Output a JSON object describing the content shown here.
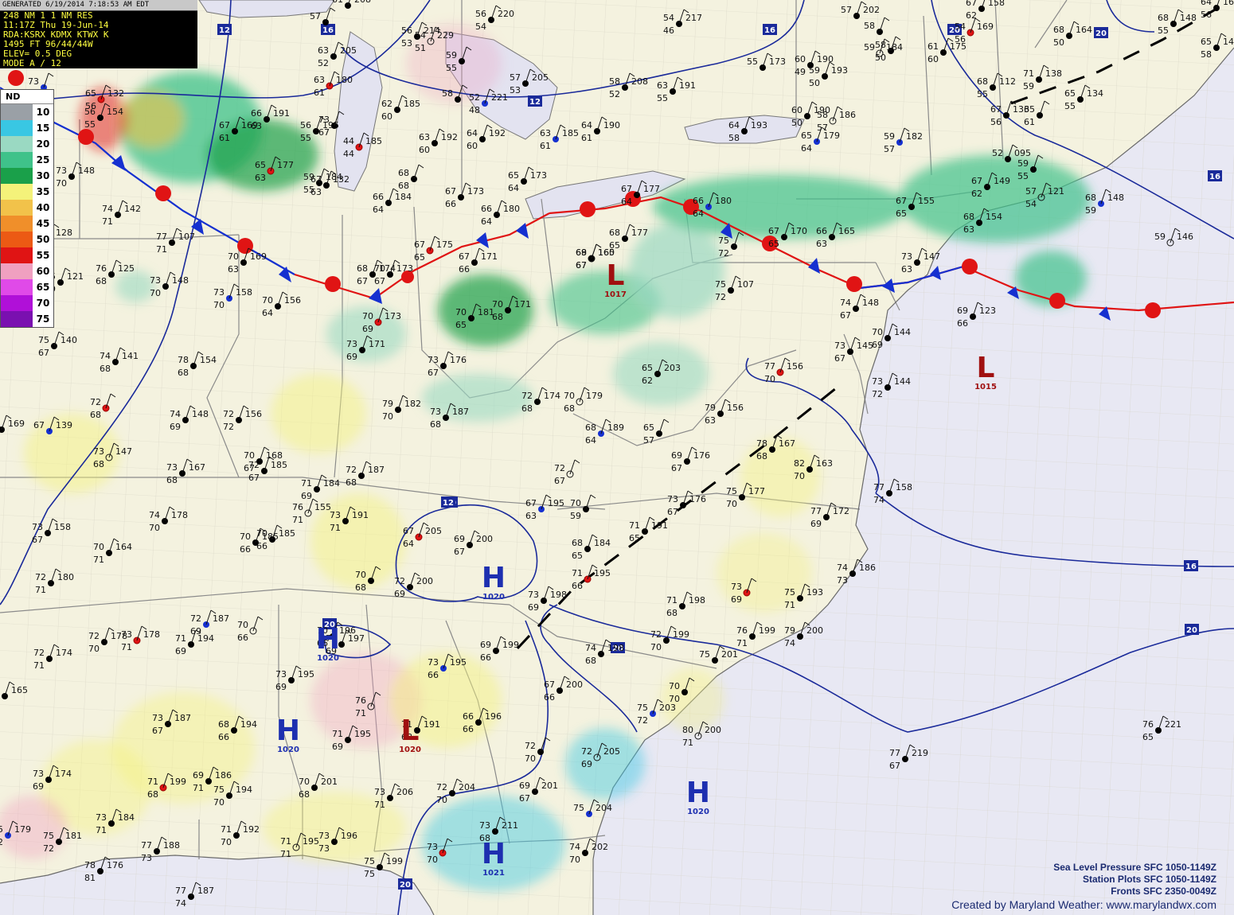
{
  "header": {
    "generated": "GENERATED 6/19/2014 7:18:53 AM EDT",
    "lines": [
      "248 NM 1 1 NM RES",
      "11:17Z Thu 19-Jun-14",
      "RDA:KSRX KDMX KTWX K",
      "1495 FT   96/44/44W",
      "ELEV= 0.5 DEG",
      "MODE A / 12"
    ]
  },
  "legend": {
    "nd_label": "ND",
    "bins": [
      {
        "label": "10",
        "color": "#9aa0a6"
      },
      {
        "label": "15",
        "color": "#39c7e3"
      },
      {
        "label": "20",
        "color": "#9ad9c2"
      },
      {
        "label": "25",
        "color": "#3fc28a"
      },
      {
        "label": "30",
        "color": "#1aa04a"
      },
      {
        "label": "35",
        "color": "#f4f27a"
      },
      {
        "label": "40",
        "color": "#f2c24a"
      },
      {
        "label": "45",
        "color": "#f08f2a"
      },
      {
        "label": "50",
        "color": "#ec5a14"
      },
      {
        "label": "55",
        "color": "#e01414"
      },
      {
        "label": "60",
        "color": "#f0a0c0"
      },
      {
        "label": "65",
        "color": "#e04ae8"
      },
      {
        "label": "70",
        "color": "#b010d8"
      },
      {
        "label": "75",
        "color": "#7a10b0"
      }
    ]
  },
  "centers": [
    {
      "type": "L",
      "value": "1017"
    },
    {
      "type": "L",
      "value": "1015"
    },
    {
      "type": "H",
      "value": "1020"
    },
    {
      "type": "H",
      "value": "1020"
    },
    {
      "type": "H",
      "value": "1020"
    },
    {
      "type": "L",
      "value": "1020"
    },
    {
      "type": "H",
      "value": "1020"
    },
    {
      "type": "H",
      "value": "1021"
    }
  ],
  "isobar_labels": [
    "12",
    "16",
    "20",
    "20",
    "20",
    "16",
    "12",
    "16",
    "20",
    "20",
    "20",
    "20",
    "12",
    "16",
    "20"
  ],
  "stations": [
    {
      "t": "73",
      "d": "70",
      "p": ""
    },
    {
      "t": "70",
      "d": "67",
      "p": "173"
    },
    {
      "t": "67",
      "d": "61",
      "p": "169"
    },
    {
      "t": "66",
      "d": "63",
      "p": "191"
    },
    {
      "t": "65",
      "d": "63",
      "p": "177"
    },
    {
      "t": "58",
      "d": "52",
      "p": "208"
    },
    {
      "t": "63",
      "d": "55",
      "p": "191"
    },
    {
      "t": "64",
      "d": "58",
      "p": "193"
    },
    {
      "t": "67",
      "d": "65",
      "p": "170"
    },
    {
      "t": "66",
      "d": "63",
      "p": "165"
    },
    {
      "t": "67",
      "d": "65",
      "p": "155"
    },
    {
      "t": "68",
      "d": "63",
      "p": "154"
    },
    {
      "t": "67",
      "d": "62",
      "p": "149"
    },
    {
      "t": "59",
      "d": "",
      "p": "146"
    },
    {
      "t": "66",
      "d": "64",
      "p": "180"
    },
    {
      "t": "67",
      "d": "64",
      "p": "177"
    },
    {
      "t": "70",
      "d": "65",
      "p": "181"
    },
    {
      "t": "68",
      "d": "65",
      "p": "177"
    },
    {
      "t": "70",
      "d": "69",
      "p": "173"
    },
    {
      "t": "73",
      "d": "69",
      "p": "171"
    },
    {
      "t": "78",
      "d": "68",
      "p": "154"
    },
    {
      "t": "74",
      "d": "68",
      "p": "141"
    },
    {
      "t": "75",
      "d": "67",
      "p": "140"
    },
    {
      "t": "73",
      "d": "67",
      "p": "176"
    },
    {
      "t": "79",
      "d": "70",
      "p": "182"
    },
    {
      "t": "73",
      "d": "68",
      "p": "187"
    },
    {
      "t": "72",
      "d": "68",
      "p": "174"
    },
    {
      "t": "70",
      "d": "68",
      "p": "179"
    },
    {
      "t": "68",
      "d": "64",
      "p": "189"
    },
    {
      "t": "65",
      "d": "57",
      "p": ""
    },
    {
      "t": "65",
      "d": "62",
      "p": "203"
    },
    {
      "t": "79",
      "d": "63",
      "p": "156"
    },
    {
      "t": "77",
      "d": "70",
      "p": "156"
    },
    {
      "t": "73",
      "d": "63",
      "p": "147"
    },
    {
      "t": "73",
      "d": "67",
      "p": "145"
    },
    {
      "t": "74",
      "d": "67",
      "p": "148"
    },
    {
      "t": "70",
      "d": "69",
      "p": "144"
    },
    {
      "t": "73",
      "d": "72",
      "p": "144"
    },
    {
      "t": "69",
      "d": "66",
      "p": "123"
    },
    {
      "t": "76",
      "d": "65",
      "p": "221"
    },
    {
      "t": "77",
      "d": "67",
      "p": "219"
    },
    {
      "t": "80",
      "d": "71",
      "p": "200"
    },
    {
      "t": "75",
      "d": "72",
      "p": "203"
    },
    {
      "t": "76",
      "d": "71",
      "p": "199"
    },
    {
      "t": "79",
      "d": "74",
      "p": "200"
    },
    {
      "t": "75",
      "d": "71",
      "p": "193"
    },
    {
      "t": "73",
      "d": "69",
      "p": ""
    },
    {
      "t": "77",
      "d": "69",
      "p": "172"
    },
    {
      "t": "74",
      "d": "73",
      "p": "186"
    },
    {
      "t": "77",
      "d": "74",
      "p": "158"
    },
    {
      "t": "82",
      "d": "70",
      "p": "163"
    },
    {
      "t": "78",
      "d": "68",
      "p": "167"
    },
    {
      "t": "75",
      "d": "70",
      "p": "177"
    },
    {
      "t": "73",
      "d": "67",
      "p": "176"
    },
    {
      "t": "69",
      "d": "67",
      "p": "176"
    },
    {
      "t": "72",
      "d": "67",
      "p": ""
    },
    {
      "t": "67",
      "d": "63",
      "p": "195"
    },
    {
      "t": "70",
      "d": "59",
      "p": ""
    },
    {
      "t": "68",
      "d": "65",
      "p": "184"
    },
    {
      "t": "71",
      "d": "65",
      "p": "191"
    },
    {
      "t": "71",
      "d": "66",
      "p": "195"
    },
    {
      "t": "73",
      "d": "69",
      "p": "198"
    },
    {
      "t": "71",
      "d": "68",
      "p": "198"
    },
    {
      "t": "72",
      "d": "70",
      "p": "199"
    },
    {
      "t": "74",
      "d": "68",
      "p": "198"
    },
    {
      "t": "75",
      "d": "",
      "p": "201"
    },
    {
      "t": "67",
      "d": "66",
      "p": "200"
    },
    {
      "t": "70",
      "d": "70",
      "p": ""
    },
    {
      "t": "72",
      "d": "70",
      "p": ""
    },
    {
      "t": "72",
      "d": "69",
      "p": "205"
    },
    {
      "t": "75",
      "d": "",
      "p": "204"
    },
    {
      "t": "74",
      "d": "70",
      "p": "202"
    },
    {
      "t": "69",
      "d": "67",
      "p": "201"
    },
    {
      "t": "73",
      "d": "68",
      "p": "211"
    },
    {
      "t": "73",
      "d": "70",
      "p": ""
    },
    {
      "t": "72",
      "d": "70",
      "p": "204"
    },
    {
      "t": "73",
      "d": "71",
      "p": "206"
    },
    {
      "t": "70",
      "d": "68",
      "p": "201"
    },
    {
      "t": "73",
      "d": "73",
      "p": "196"
    },
    {
      "t": "75",
      "d": "75",
      "p": "199"
    },
    {
      "t": "71",
      "d": "69",
      "p": "195"
    },
    {
      "t": "66",
      "d": "66",
      "p": "196"
    },
    {
      "t": "71",
      "d": "68",
      "p": "191"
    },
    {
      "t": "76",
      "d": "71",
      "p": ""
    },
    {
      "t": "73",
      "d": "66",
      "p": "195"
    },
    {
      "t": "69",
      "d": "66",
      "p": "199"
    },
    {
      "t": "72",
      "d": "69",
      "p": "200"
    },
    {
      "t": "70",
      "d": "68",
      "p": ""
    },
    {
      "t": "67",
      "d": "64",
      "p": "205"
    },
    {
      "t": "69",
      "d": "67",
      "p": "200"
    },
    {
      "t": "73",
      "d": "71",
      "p": "191"
    },
    {
      "t": "70",
      "d": "66",
      "p": "185"
    },
    {
      "t": "72",
      "d": "68",
      "p": "187"
    },
    {
      "t": "71",
      "d": "69",
      "p": "184"
    },
    {
      "t": "70",
      "d": "66",
      "p": "196"
    },
    {
      "t": "73",
      "d": "69",
      "p": "195"
    },
    {
      "t": "70",
      "d": "69",
      "p": "197"
    },
    {
      "t": "70",
      "d": "66",
      "p": ""
    },
    {
      "t": "72",
      "d": "69",
      "p": "187"
    },
    {
      "t": "68",
      "d": "66",
      "p": "194"
    },
    {
      "t": "73",
      "d": "67",
      "p": "187"
    },
    {
      "t": "72",
      "d": "70",
      "p": "178"
    },
    {
      "t": "73",
      "d": "71",
      "p": "178"
    },
    {
      "t": "72",
      "d": "71",
      "p": "174"
    },
    {
      "t": "75",
      "d": "73",
      "p": "165"
    },
    {
      "t": "69",
      "d": "71",
      "p": "186"
    },
    {
      "t": "71",
      "d": "69",
      "p": "194"
    },
    {
      "t": "73",
      "d": "71",
      "p": "184"
    },
    {
      "t": "75",
      "d": "72",
      "p": "181"
    },
    {
      "t": "77",
      "d": "73",
      "p": "188"
    },
    {
      "t": "71",
      "d": "70",
      "p": "192"
    },
    {
      "t": "71",
      "d": "71",
      "p": "195"
    },
    {
      "t": "75",
      "d": "72",
      "p": "179"
    },
    {
      "t": "78",
      "d": "81",
      "p": "176"
    },
    {
      "t": "77",
      "d": "74",
      "p": "187"
    },
    {
      "t": "75",
      "d": "70",
      "p": "194"
    },
    {
      "t": "71",
      "d": "68",
      "p": "199"
    },
    {
      "t": "73",
      "d": "69",
      "p": "174"
    },
    {
      "t": "72",
      "d": "71",
      "p": "180"
    },
    {
      "t": "70",
      "d": "71",
      "p": "164"
    },
    {
      "t": "73",
      "d": "67",
      "p": "158"
    },
    {
      "t": "74",
      "d": "70",
      "p": "178"
    },
    {
      "t": "70",
      "d": "66",
      "p": "185"
    },
    {
      "t": "72",
      "d": "67",
      "p": "185"
    },
    {
      "t": "73",
      "d": "68",
      "p": "167"
    },
    {
      "t": "73",
      "d": "68",
      "p": "147"
    },
    {
      "t": "67",
      "d": "",
      "p": "139"
    },
    {
      "t": "76",
      "d": "70",
      "p": "169"
    },
    {
      "t": "70",
      "d": "67",
      "p": "168"
    },
    {
      "t": "72",
      "d": "72",
      "p": "156"
    },
    {
      "t": "72",
      "d": "68",
      "p": ""
    },
    {
      "t": "74",
      "d": "69",
      "p": "148"
    },
    {
      "t": "73",
      "d": "70",
      "p": "148"
    },
    {
      "t": "76",
      "d": "68",
      "p": "125"
    },
    {
      "t": "75",
      "d": "69",
      "p": "121"
    },
    {
      "t": "76",
      "d": "69",
      "p": "128"
    },
    {
      "t": "74",
      "d": "71",
      "p": "142"
    },
    {
      "t": "77",
      "d": "71",
      "p": "107"
    },
    {
      "t": "73",
      "d": "70",
      "p": "148"
    },
    {
      "t": "76",
      "d": "71",
      "p": "155"
    },
    {
      "t": "73",
      "d": "70",
      "p": "158"
    },
    {
      "t": "70",
      "d": "64",
      "p": "156"
    },
    {
      "t": "70",
      "d": "63",
      "p": "169"
    },
    {
      "t": "68",
      "d": "67",
      "p": "174"
    },
    {
      "t": "67",
      "d": "65",
      "p": "175"
    },
    {
      "t": "66",
      "d": "64",
      "p": "184"
    },
    {
      "t": "68",
      "d": "68",
      "p": ""
    },
    {
      "t": "67",
      "d": "66",
      "p": "173"
    },
    {
      "t": "66",
      "d": "64",
      "p": "180"
    },
    {
      "t": "65",
      "d": "64",
      "p": "173"
    },
    {
      "t": "67",
      "d": "66",
      "p": "171"
    },
    {
      "t": "70",
      "d": "68",
      "p": "171"
    },
    {
      "t": "69",
      "d": "67",
      "p": "160"
    },
    {
      "t": "68",
      "d": "67",
      "p": "165"
    },
    {
      "t": "63",
      "d": "61",
      "p": "185"
    },
    {
      "t": "64",
      "d": "61",
      "p": "190"
    },
    {
      "t": "63",
      "d": "60",
      "p": "192"
    },
    {
      "t": "64",
      "d": "60",
      "p": "192"
    },
    {
      "t": "44",
      "d": "44",
      "p": "185"
    },
    {
      "t": "56",
      "d": "55",
      "p": "195"
    },
    {
      "t": "59",
      "d": "55",
      "p": "184"
    },
    {
      "t": "62",
      "d": "60",
      "p": "185"
    },
    {
      "t": "57",
      "d": "53",
      "p": "205"
    },
    {
      "t": "58",
      "d": "",
      "p": ""
    },
    {
      "t": "59",
      "d": "55",
      "p": ""
    },
    {
      "t": "56",
      "d": "53",
      "p": "214"
    },
    {
      "t": "56",
      "d": "54",
      "p": "220"
    },
    {
      "t": "54",
      "d": "51",
      "p": "229"
    },
    {
      "t": "52",
      "d": "48",
      "p": "221"
    },
    {
      "t": "54",
      "d": "46",
      "p": "217"
    },
    {
      "t": "63",
      "d": "52",
      "p": "205"
    },
    {
      "t": "57",
      "d": "",
      "p": ""
    },
    {
      "t": "63",
      "d": "61",
      "p": "180"
    },
    {
      "t": "61",
      "d": "",
      "p": "208"
    },
    {
      "t": "57",
      "d": "",
      "p": "202"
    },
    {
      "t": "58",
      "d": "",
      "p": ""
    },
    {
      "t": "58",
      "d": "50",
      "p": ""
    },
    {
      "t": "60",
      "d": "49",
      "p": "190"
    },
    {
      "t": "55",
      "d": "",
      "p": "173"
    },
    {
      "t": "59",
      "d": "50",
      "p": "193"
    },
    {
      "t": "60",
      "d": "50",
      "p": "190"
    },
    {
      "t": "58",
      "d": "57",
      "p": "186"
    },
    {
      "t": "59",
      "d": "57",
      "p": "182"
    },
    {
      "t": "61",
      "d": "60",
      "p": "175"
    },
    {
      "t": "67",
      "d": "62",
      "p": "158"
    },
    {
      "t": "64",
      "d": "56",
      "p": "164"
    },
    {
      "t": "54",
      "d": "56",
      "p": "169"
    },
    {
      "t": "68",
      "d": "55",
      "p": "112"
    },
    {
      "t": "68",
      "d": "50",
      "p": "164"
    },
    {
      "t": "68",
      "d": "55",
      "p": "148"
    },
    {
      "t": "65",
      "d": "58",
      "p": "144"
    },
    {
      "t": "65",
      "d": "55",
      "p": "134"
    },
    {
      "t": "67",
      "d": "56",
      "p": "133"
    },
    {
      "t": "52",
      "d": "",
      "p": "095"
    },
    {
      "t": "59",
      "d": "55",
      "p": ""
    },
    {
      "t": "57",
      "d": "54",
      "p": "121"
    },
    {
      "t": "68",
      "d": "59",
      "p": "148"
    },
    {
      "t": "71",
      "d": "59",
      "p": "138"
    },
    {
      "t": "65",
      "d": "61",
      "p": ""
    },
    {
      "t": "68",
      "d": "62",
      "p": "141"
    },
    {
      "t": "65",
      "d": "56",
      "p": "132"
    },
    {
      "t": "56",
      "d": "55",
      "p": "154"
    },
    {
      "t": "64",
      "d": "61",
      "p": "133"
    },
    {
      "t": "69",
      "d": "64",
      "p": "126"
    },
    {
      "t": "66",
      "d": "63",
      "p": "120"
    },
    {
      "t": "67",
      "d": "63",
      "p": "132"
    },
    {
      "t": "75",
      "d": "72",
      "p": ""
    },
    {
      "t": "75",
      "d": "72",
      "p": "107"
    },
    {
      "t": "73",
      "d": "67",
      "p": ""
    },
    {
      "t": "59",
      "d": "",
      "p": "184"
    },
    {
      "t": "65",
      "d": "64",
      "p": "179"
    },
    {
      "t": "66",
      "d": "63",
      "p": "173"
    },
    {
      "t": "65",
      "d": "63",
      "p": "173"
    },
    {
      "t": "59",
      "d": "",
      "p": "154"
    },
    {
      "t": "58",
      "d": "",
      "p": "180"
    },
    {
      "t": "63",
      "d": "61",
      "p": "163"
    }
  ],
  "credits": {
    "lines": [
      "Sea Level Pressure SFC 1050-1149Z",
      "Station Plots SFC 1050-1149Z",
      "Fronts SFC 2350-0049Z"
    ],
    "created_by": "Created by Maryland Weather: www.marylandwx.com"
  },
  "colors": {
    "isobar": "#1a2a9a",
    "cold_front": "#1530d0",
    "warm_front": "#e01414",
    "high": "#1d2fb0",
    "low": "#a01010"
  }
}
